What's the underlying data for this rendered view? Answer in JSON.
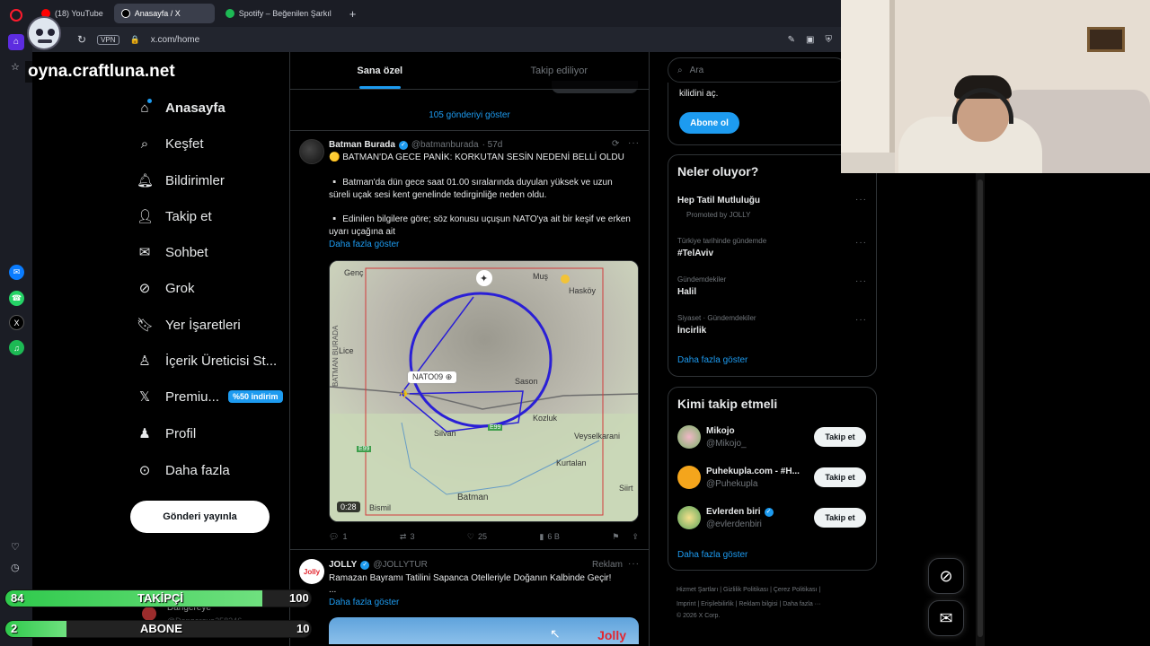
{
  "browser": {
    "tabs": [
      {
        "label": "(18) YouTube",
        "color": "#ff0000"
      },
      {
        "label": "Anasayfa / X",
        "color": "#ffffff"
      },
      {
        "label": "Spotify – Beğenilen Şarkıl",
        "color": "#1db954"
      }
    ],
    "vpn_label": "VPN",
    "url": "x.com/home"
  },
  "overlay": {
    "streamer_link": "oyna.craftluna.net",
    "followers": {
      "label": "TAKİPÇİ",
      "current": "84",
      "goal": "100",
      "progress": 0.84
    },
    "subscribers": {
      "label": "ABONE",
      "current": "2",
      "goal": "10",
      "progress": 0.2
    },
    "partial_name": "Dangereye",
    "partial_handle": "@Dangereye258246"
  },
  "nav": {
    "items": [
      {
        "label": "Anasayfa",
        "icon": "home-icon"
      },
      {
        "label": "Keşfet",
        "icon": "search-icon"
      },
      {
        "label": "Bildirimler",
        "icon": "bell-icon"
      },
      {
        "label": "Takip et",
        "icon": "add-user-icon"
      },
      {
        "label": "Sohbet",
        "icon": "mail-icon"
      },
      {
        "label": "Grok",
        "icon": "grok-icon"
      },
      {
        "label": "Yer İşaretleri",
        "icon": "bookmark-icon"
      },
      {
        "label": "İçerik Üreticisi St...",
        "icon": "creator-icon"
      },
      {
        "label": "Premiu...",
        "icon": "x-logo-icon"
      },
      {
        "label": "Profil",
        "icon": "person-icon"
      },
      {
        "label": "Daha fazla",
        "icon": "more-icon"
      }
    ],
    "premium_badge": "%50 indirim",
    "post_button": "Gönderi yayınla"
  },
  "feed": {
    "tabs": [
      "Sana özel",
      "Takip ediliyor"
    ],
    "show_posts": "105 gönderiyi göster",
    "tweet1": {
      "name": "Batman Burada",
      "handle": "@batmanburada",
      "time": "· 57d",
      "headline": "🟡 BATMAN'DA GECE PANİK: KORKUTAN SESİN NEDENİ BELLİ OLDU",
      "para1": "▫️ Batman'da dün gece saat 01.00 sıralarında duyulan yüksek ve uzun süreli uçak sesi kent genelinde tedirginliğe neden oldu.",
      "para2": "▫️ Edinilen bilgilere göre; söz konusu uçuşun NATO'ya ait bir keşif ve erken uyarı uçağına ait",
      "show_more": "Daha fazla göster",
      "video_time": "0:28",
      "map_labels": {
        "genc": "Genç",
        "mus": "Muş",
        "haskoy": "Hasköy",
        "lice": "Lice",
        "batman_burada": "BATMAN BURADA",
        "nato": "NATO09",
        "sason": "Sason",
        "kozluk": "Kozluk",
        "veysel": "Veyselkarani",
        "silvan": "Silvan",
        "e99a": "E99",
        "e99b": "E99",
        "kurtalan": "Kurtalan",
        "batman": "Batman",
        "bismil": "Bismil",
        "siirt": "Siirt"
      },
      "replies": "1",
      "reposts": "3",
      "likes": "25",
      "views": "6 B"
    },
    "tweet2": {
      "name": "JOLLY",
      "handle": "@JOLLYTUR",
      "ad_label": "Reklam",
      "text": "Ramazan Bayramı Tatilini Sapanca Otelleriyle Doğanın Kalbinde Geçir!",
      "ellipsis": "...",
      "show_more": "Daha fazla göster",
      "avatar_text": "Jolly"
    }
  },
  "right": {
    "search_placeholder": "Ara",
    "premium_text": "kilidini aç.",
    "subscribe_button": "Abone ol",
    "trends_title": "Neler oluyor?",
    "trends": [
      {
        "category": "",
        "name": "Hep Tatil Mutluluğu",
        "promo": "Promoted by JOLLY"
      },
      {
        "category": "Türkiye tarihinde gündemde",
        "name": "#TelAviv"
      },
      {
        "category": "Gündemdekiler",
        "name": "Halil"
      },
      {
        "category": "Siyaset · Gündemdekiler",
        "name": "İncirlik"
      }
    ],
    "trends_more": "Daha fazla göster",
    "who_title": "Kimi takip etmeli",
    "who": [
      {
        "name": "Mikojo",
        "handle": "@Mikojo_",
        "button": "Takip et"
      },
      {
        "name": "Puhekupla.com - #H...",
        "handle": "@Puhekupla",
        "button": "Takip et"
      },
      {
        "name": "Evlerden biri",
        "handle": "@evlerdenbiri",
        "button": "Takip et"
      }
    ],
    "who_more": "Daha fazla göster",
    "footer": {
      "line1": "Hizmet Şartları  |  Gizlilik Politikası  |  Çerez Politikası  |",
      "line2": "Imprint  |  Erişilebilirlik  |  Reklam bilgisi  |  Daha fazla ···",
      "line3": "© 2026 X Corp."
    }
  },
  "colors": {
    "accent": "#1d9bf0",
    "background": "#000000",
    "border": "#2f3336"
  }
}
